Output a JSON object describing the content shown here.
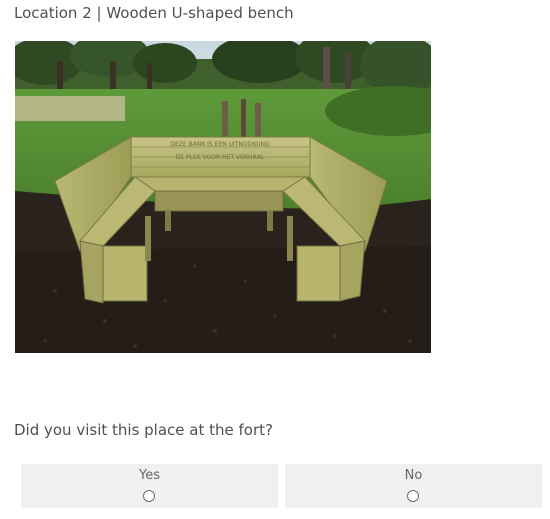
{
  "page": {
    "title": "Location 2 | Wooden U-shaped bench",
    "image_alt": "Wooden U-shaped bench on a field",
    "bench_inscription_line1": "DEZE BANK IS EEN UITNODIGING",
    "bench_inscription_line2": "DE PLEK VOOR HET VERHAAL"
  },
  "question": {
    "text": "Did you visit this place at the fort?",
    "options": [
      {
        "label": "Yes",
        "selected": false
      },
      {
        "label": "No",
        "selected": false
      }
    ]
  },
  "colors": {
    "background": "#ffffff",
    "option_background": "#f0f0f0",
    "text": "#505050"
  }
}
